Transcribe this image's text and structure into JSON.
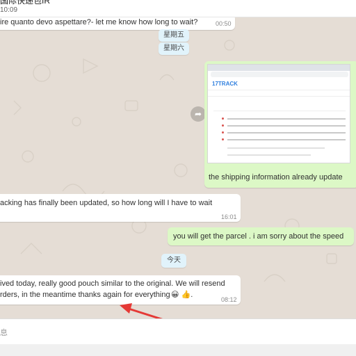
{
  "header": {
    "contact_name": "国际快递包IR",
    "last_seen": "10:09"
  },
  "messages": [
    {
      "type": "in",
      "text": "ire quanto devo aspettare?- let me know how long to wait?",
      "time": "00:50"
    },
    {
      "type": "date",
      "text": "星期五"
    },
    {
      "type": "date",
      "text": "星期六"
    },
    {
      "type": "out_image",
      "caption": "the shipping information already update",
      "image": {
        "logo": "17TRACK"
      }
    },
    {
      "type": "in",
      "text": "acking has finally been updated, so how long will I have to wait",
      "time": "16:01"
    },
    {
      "type": "out",
      "text": "you will get the parcel . i am sorry about the speed"
    },
    {
      "type": "date",
      "text": "今天"
    },
    {
      "type": "in",
      "text1": "ived today, really good pouch similar to the original. We will resend",
      "text2": "rders, in the meantime thanks again for everything",
      "emoji": "😀 👍.",
      "time": "08:12"
    }
  ],
  "composer": {
    "placeholder": "息"
  },
  "colors": {
    "incoming": "#ffffff",
    "outgoing": "#dcf8c6",
    "date_chip": "#e1f3fb",
    "annotation_arrow": "#e53935"
  },
  "icons": {
    "forward": "forward-icon"
  }
}
